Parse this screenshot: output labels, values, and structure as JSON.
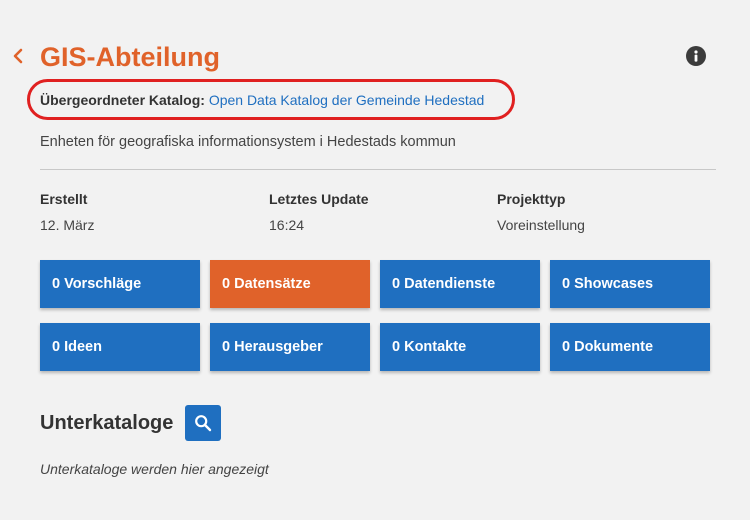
{
  "header": {
    "back_icon": "chevron-left-icon",
    "title": "GIS-Abteilung",
    "info_icon": "info-icon"
  },
  "parent_catalog": {
    "label": "Übergeordneter Katalog:",
    "link_text": "Open Data Katalog der Gemeinde Hedestad"
  },
  "description": "Enheten för geografiska informationsystem i Hedestads kommun",
  "meta": [
    {
      "label": "Erstellt",
      "value": "12. März"
    },
    {
      "label": "Letztes Update",
      "value": "16:24"
    },
    {
      "label": "Projekttyp",
      "value": "Voreinstellung"
    }
  ],
  "tiles": [
    {
      "label": "0 Vorschläge",
      "active": false
    },
    {
      "label": "0 Datensätze",
      "active": true
    },
    {
      "label": "0 Datendienste",
      "active": false
    },
    {
      "label": "0 Showcases",
      "active": false
    },
    {
      "label": "0 Ideen",
      "active": false
    },
    {
      "label": "0 Herausgeber",
      "active": false
    },
    {
      "label": "0 Kontakte",
      "active": false
    },
    {
      "label": "0 Dokumente",
      "active": false
    }
  ],
  "subcatalogs": {
    "title": "Unterkataloge",
    "search_icon": "search-icon",
    "empty_hint": "Unterkataloge werden hier angezeigt"
  },
  "colors": {
    "accent_orange": "#e0622a",
    "primary_blue": "#1f6fc0",
    "highlight_red": "#e02020",
    "background": "#f2f2f2"
  }
}
